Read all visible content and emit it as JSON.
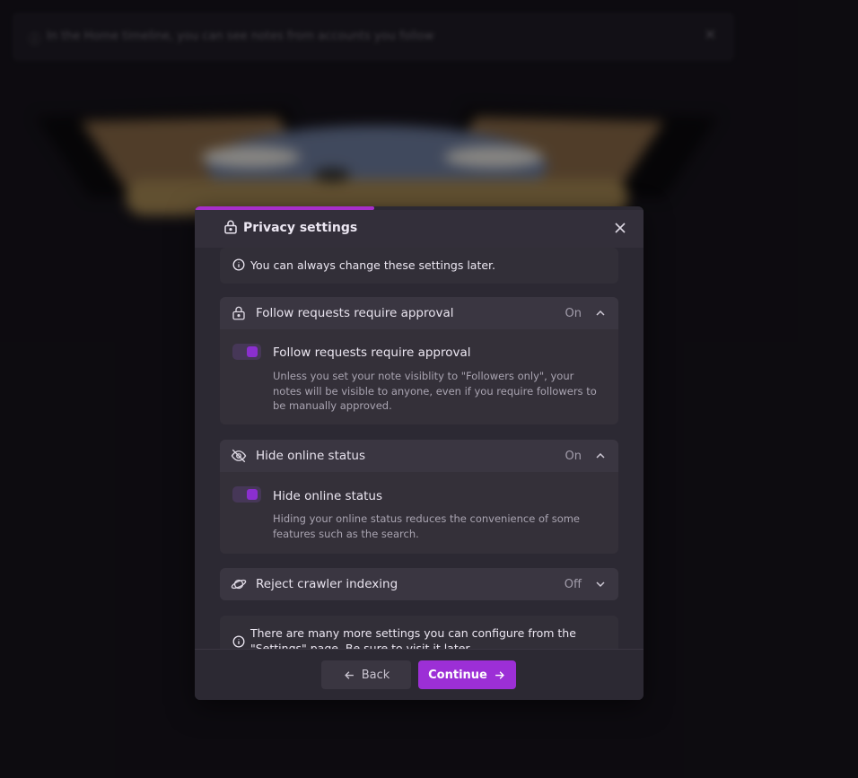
{
  "background": {
    "banner_text": "In the Home timeline, you can see notes from accounts you follow"
  },
  "modal": {
    "title": "Privacy settings",
    "progress_fraction": 0.4,
    "intro_note": "You can always change these settings later.",
    "sections": [
      {
        "label": "Follow requests require approval",
        "value": "On",
        "expanded": true,
        "icon": "lock-icon",
        "option_label": "Follow requests require approval",
        "option_desc": "Unless you set your note visiblity to \"Followers only\", your notes will be visible to anyone, even if you require followers to be manually approved.",
        "toggle_on": true
      },
      {
        "label": "Hide online status",
        "value": "On",
        "expanded": true,
        "icon": "eye-off-icon",
        "option_label": "Hide online status",
        "option_desc": "Hiding your online status reduces the convenience of some features such as the search.",
        "toggle_on": true
      },
      {
        "label": "Reject crawler indexing",
        "value": "Off",
        "expanded": false,
        "icon": "planet-icon"
      }
    ],
    "outro_note": "There are many more settings you can configure from the \"Settings\" page. Be sure to visit it later.",
    "back_label": "Back",
    "continue_label": "Continue"
  },
  "colors": {
    "accent": "#9c2fd6",
    "background": "#17141c",
    "modal": "#2c2933"
  }
}
